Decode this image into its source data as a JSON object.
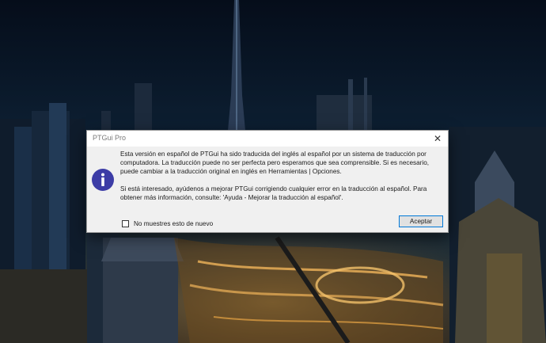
{
  "dialog": {
    "title": "PTGui Pro",
    "close_glyph": "✕",
    "icon": "info-icon",
    "icon_glyph": "i",
    "accent_color": "#3c3ca6",
    "message_paragraph_1": "Esta versión en español de PTGui ha sido traducida del inglés al español por un sistema de traducción por computadora. La traducción puede no ser perfecta pero esperamos que sea comprensible. Si es necesario, puede cambiar a la traducción original en inglés en Herramientas | Opciones.",
    "message_paragraph_2": "Si está interesado, ayúdenos a mejorar PTGui corrigiendo cualquier error en la traducción al español. Para obtener más información, consulte: 'Ayuda - Mejorar la traducción al español'.",
    "checkbox_label": "No muestres esto de nuevo",
    "checkbox_checked": false,
    "accept_label": "Aceptar"
  },
  "background": {
    "description_icon": "city-night-wallpaper"
  }
}
